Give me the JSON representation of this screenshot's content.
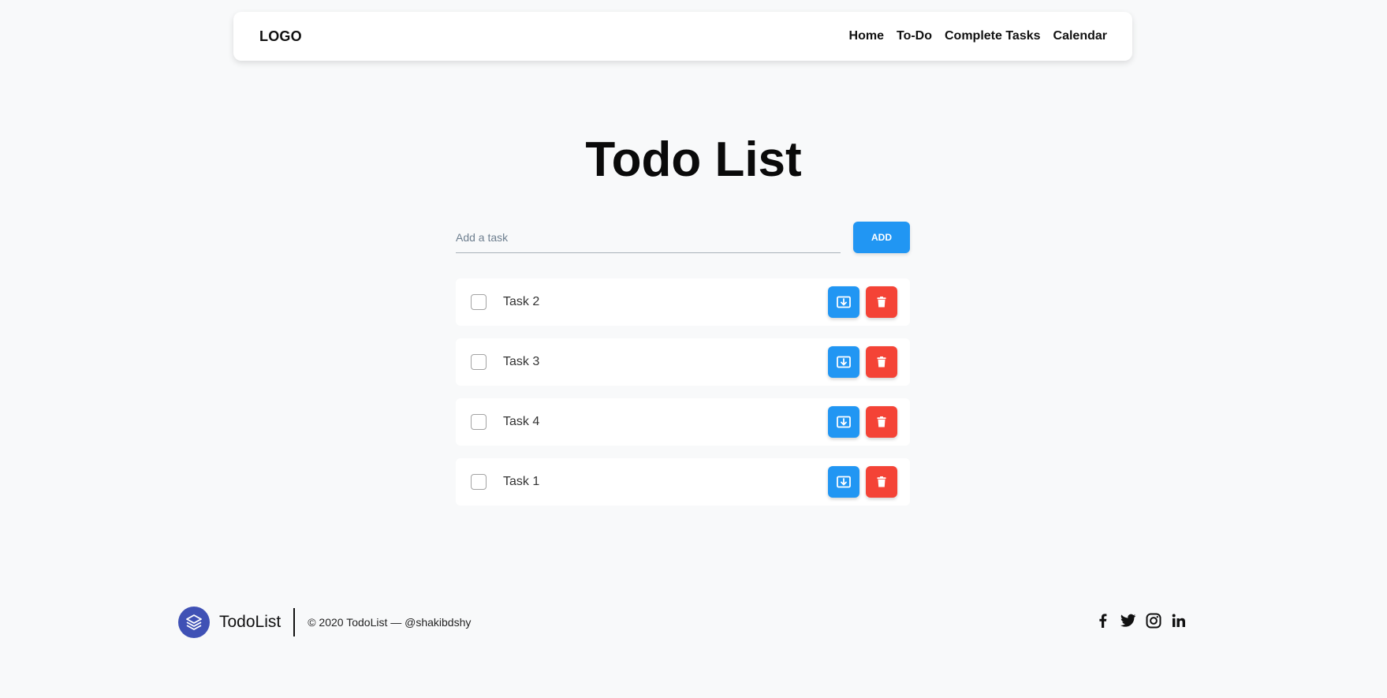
{
  "navbar": {
    "logo": "LOGO",
    "links": [
      "Home",
      "To-Do",
      "Complete Tasks",
      "Calendar"
    ]
  },
  "main": {
    "title": "Todo List",
    "input_placeholder": "Add a task",
    "input_value": "",
    "add_button_label": "ADD",
    "tasks": [
      {
        "label": "Task 2",
        "checked": false
      },
      {
        "label": "Task 3",
        "checked": false
      },
      {
        "label": "Task 4",
        "checked": false
      },
      {
        "label": "Task 1",
        "checked": false
      }
    ]
  },
  "footer": {
    "brand_name": "TodoList",
    "copyright": "© 2020 TodoList — @shakibdshy",
    "social": [
      "facebook-icon",
      "twitter-icon",
      "instagram-icon",
      "linkedin-icon"
    ]
  },
  "colors": {
    "primary": "#2196f3",
    "danger": "#f44336",
    "brand": "#3f51b5",
    "background": "#f8f9fa"
  }
}
